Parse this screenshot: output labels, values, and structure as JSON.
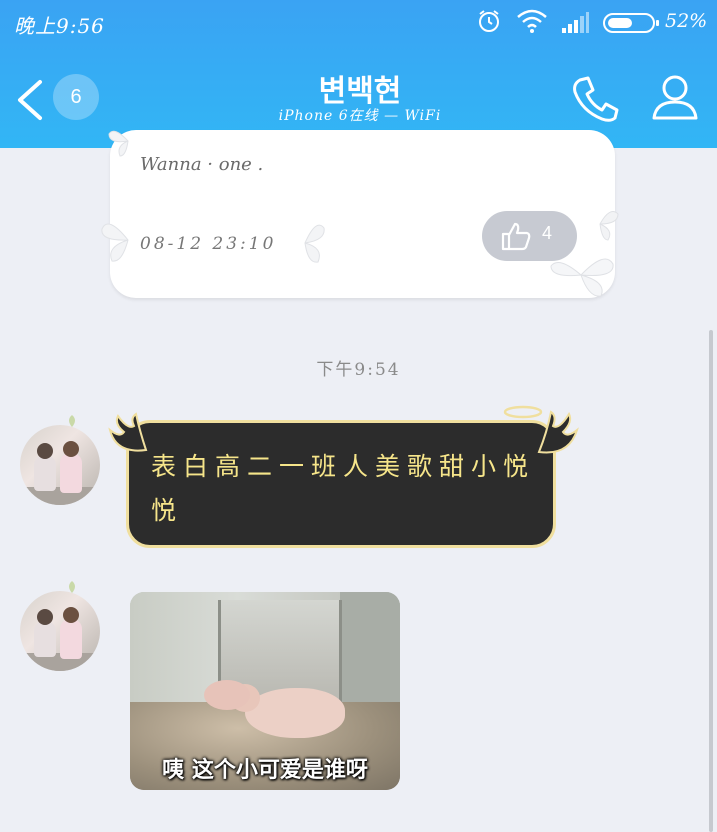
{
  "status_bar": {
    "time": "晚上9:56",
    "battery_percent": "52%",
    "icons": [
      "alarm-icon",
      "wifi-icon",
      "signal-icon",
      "battery-icon"
    ]
  },
  "header": {
    "unread_count": "6",
    "title": "변백현",
    "subtitle": "iPhone 6在线 — WiFi",
    "colors": {
      "background": "#38abf4",
      "foreground": "#ffffff"
    }
  },
  "messages": {
    "card": {
      "text": "Wanna · one .",
      "timestamp": "08-12 23:10",
      "like_count": "4"
    },
    "time_divider": "下午9:54",
    "text_bubble": {
      "text": "表白高二一班人美歌甜小悦悦",
      "colors": {
        "bubble": "#2c2c2c",
        "text": "#f6e58a",
        "border": "#f0df9e"
      }
    },
    "image_message": {
      "caption": "咦 这个小可爱是谁呀"
    }
  }
}
